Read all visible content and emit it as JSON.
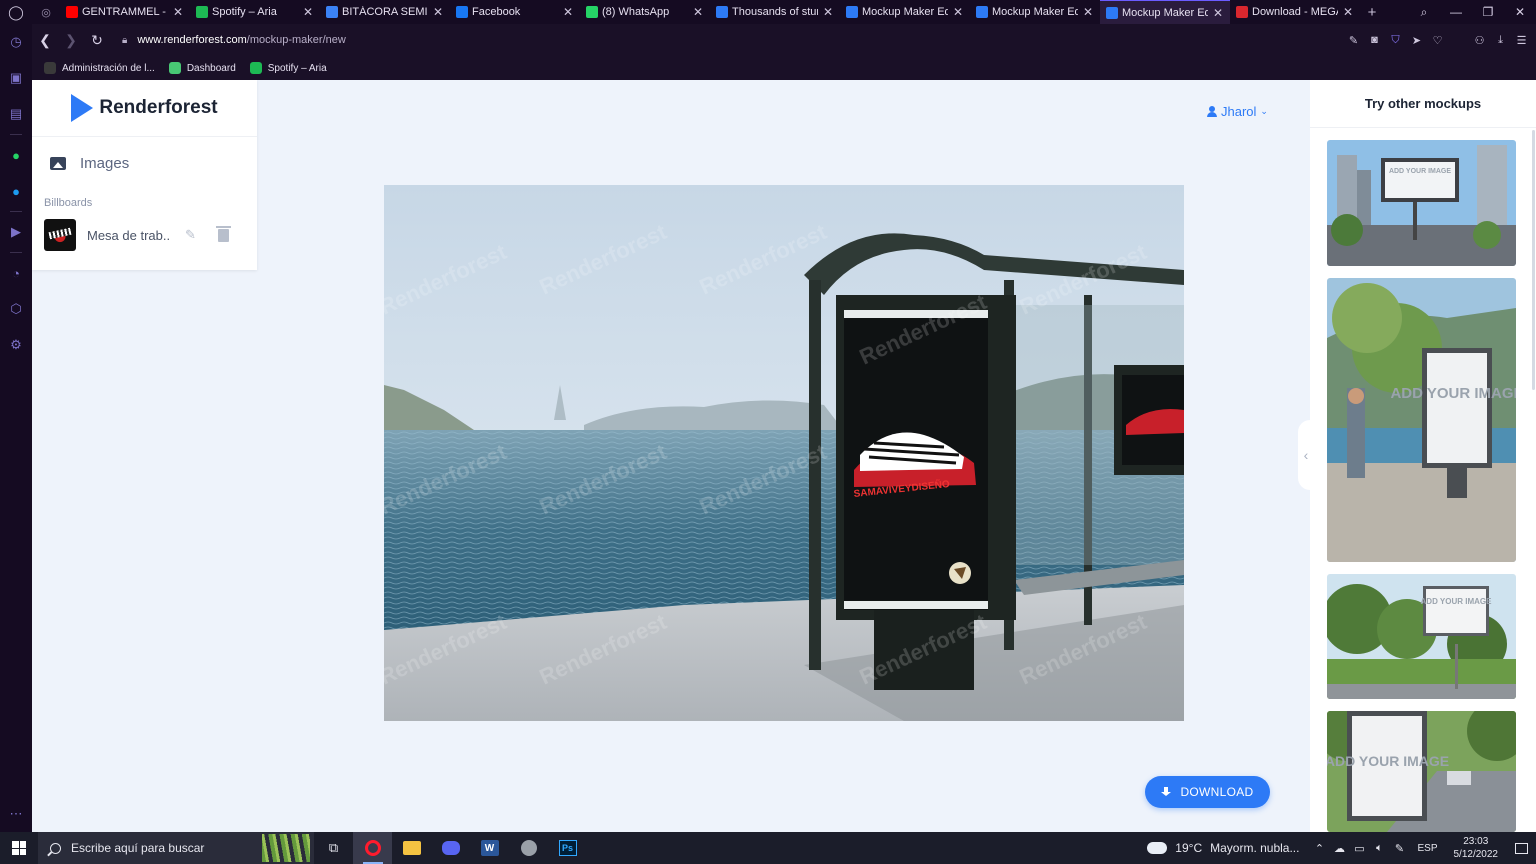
{
  "browser": {
    "tabs": [
      {
        "label": "GENTRAMMEL - Ou",
        "favicon_color": "#ff0000",
        "active": false
      },
      {
        "label": "Spotify – Aria",
        "favicon_color": "#1db954",
        "active": false
      },
      {
        "label": "BITÁCORA SEMIÓTIC",
        "favicon_color": "#3b82f6",
        "active": false
      },
      {
        "label": "Facebook",
        "favicon_color": "#1877f2",
        "active": false
      },
      {
        "label": "(8) WhatsApp",
        "favicon_color": "#25d366",
        "active": false
      },
      {
        "label": "Thousands of stunni",
        "favicon_color": "#2d7af6",
        "active": false
      },
      {
        "label": "Mockup Maker Edito",
        "favicon_color": "#2d7af6",
        "active": false
      },
      {
        "label": "Mockup Maker Edito",
        "favicon_color": "#2d7af6",
        "active": false
      },
      {
        "label": "Mockup Maker Edito",
        "favicon_color": "#2d7af6",
        "active": true
      },
      {
        "label": "Download - MEGA",
        "favicon_color": "#d9272e",
        "active": false
      }
    ],
    "url_domain": "www.renderforest.com",
    "url_path": "/mockup-maker/new",
    "bookmarks": [
      {
        "label": "Administración de l...",
        "color": "#3a3a3a"
      },
      {
        "label": "Dashboard",
        "color": "#48c774"
      },
      {
        "label": "Spotify – Aria",
        "color": "#1db954"
      }
    ]
  },
  "app": {
    "brand": "Renderforest",
    "brand_color": "#2d7af6",
    "sidebar": {
      "section_label": "Images",
      "group_title": "Billboards",
      "layers": [
        {
          "name": "Mesa de trab..."
        }
      ]
    },
    "user": {
      "name": "Jharol"
    },
    "download_label": "DOWNLOAD",
    "right_panel": {
      "title": "Try other mockups",
      "thumbnails": [
        {
          "name": "billboard-city-street",
          "text": "ADD YOUR IMAGE"
        },
        {
          "name": "billboard-seaside-walkway",
          "text": "ADD YOUR IMAGE"
        },
        {
          "name": "billboard-trees",
          "text": "ADD YOUR IMAGE"
        },
        {
          "name": "billboard-highway",
          "text": "ADD YOUR IMAGE"
        }
      ]
    },
    "mockup": {
      "watermark": "Renderforest",
      "poster_text": "SAMAVIVEYDISEÑO"
    }
  },
  "taskbar": {
    "search_placeholder": "Escribe aquí para buscar",
    "weather_temp": "19°C",
    "weather_desc": "Mayorm. nubla...",
    "language": "ESP",
    "time": "23:03",
    "date": "5/12/2022"
  }
}
